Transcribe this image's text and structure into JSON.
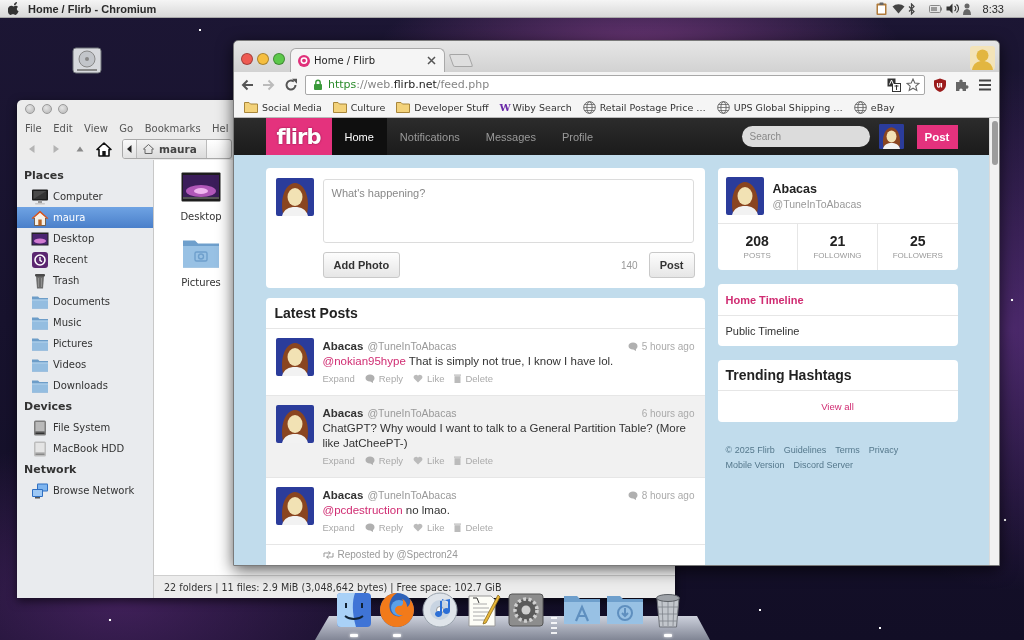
{
  "menu_bar": {
    "title": "Home / Flirb - Chromium",
    "clock": "8:33"
  },
  "file_manager": {
    "menu": [
      "File",
      "Edit",
      "View",
      "Go",
      "Bookmarks",
      "Hel"
    ],
    "path": "maura",
    "sidebar": [
      {
        "heading": "Places",
        "items": [
          {
            "label": "Computer",
            "kind": "computer",
            "selected": false
          },
          {
            "label": "maura",
            "kind": "home",
            "selected": true
          },
          {
            "label": "Desktop",
            "kind": "wallpaper",
            "selected": false
          },
          {
            "label": "Recent",
            "kind": "recent",
            "selected": false
          },
          {
            "label": "Trash",
            "kind": "trash",
            "selected": false
          },
          {
            "label": "Documents",
            "kind": "folder",
            "selected": false
          },
          {
            "label": "Music",
            "kind": "folder",
            "selected": false
          },
          {
            "label": "Pictures",
            "kind": "folder",
            "selected": false
          },
          {
            "label": "Videos",
            "kind": "folder",
            "selected": false
          },
          {
            "label": "Downloads",
            "kind": "folder",
            "selected": false
          }
        ]
      },
      {
        "heading": "Devices",
        "items": [
          {
            "label": "File System",
            "kind": "drive",
            "selected": false
          },
          {
            "label": "MacBook HDD",
            "kind": "disk",
            "selected": false
          }
        ]
      },
      {
        "heading": "Network",
        "items": [
          {
            "label": "Browse Network",
            "kind": "network",
            "selected": false
          }
        ]
      }
    ],
    "files": [
      {
        "name": "Desktop",
        "kind": "wallpaper"
      },
      {
        "name": "Pictures",
        "kind": "folder"
      }
    ],
    "status_bar": "22 folders | 11 files: 2.9 MiB (3,048,642 bytes) | Free space: 102.7 GiB"
  },
  "browser": {
    "tabs": [
      {
        "title": "Home / Flirb",
        "selected": true
      }
    ],
    "url": [
      {
        "text": "https",
        "kind": "scheme"
      },
      {
        "text": "://web.",
        "kind": "dim"
      },
      {
        "text": "flirb.net",
        "kind": "host"
      },
      {
        "text": "/feed.php",
        "kind": "dim"
      }
    ],
    "bookmarks": [
      {
        "label": "Social Media",
        "kind": "folder"
      },
      {
        "label": "Culture",
        "kind": "folder"
      },
      {
        "label": "Developer Stuff",
        "kind": "folder"
      },
      {
        "label": "Wiby Search",
        "kind": "letter",
        "icon": "W"
      },
      {
        "label": "Retail Postage Price …",
        "kind": "globe"
      },
      {
        "label": "UPS Global Shipping …",
        "kind": "globe"
      },
      {
        "label": "eBay",
        "kind": "globe"
      }
    ]
  },
  "flirb": {
    "logo": "flirb",
    "nav": [
      {
        "label": "Home",
        "selected": true
      },
      {
        "label": "Notifications",
        "selected": false
      },
      {
        "label": "Messages",
        "selected": false
      },
      {
        "label": "Profile",
        "selected": false
      }
    ],
    "search": {
      "placeholder": "Search"
    },
    "post_button": "Post",
    "compose": {
      "placeholder": "What's happening?",
      "add_photo": "Add Photo",
      "counter": "140",
      "post_button": "Post"
    },
    "feed": {
      "title": "Latest Posts",
      "posts": [
        {
          "name": "Abacas",
          "handle": "@TuneInToAbacas",
          "time": "5 hours ago",
          "in_reply": true,
          "highlighted": false,
          "mention": "@nokian95hype",
          "text": "That is simply not true, I know I have lol.",
          "actions": [
            {
              "label": "Expand",
              "kind": "expand"
            },
            {
              "label": "Reply",
              "kind": "reply"
            },
            {
              "label": "Like",
              "kind": "like"
            },
            {
              "label": "Delete",
              "kind": "delete"
            }
          ]
        },
        {
          "name": "Abacas",
          "handle": "@TuneInToAbacas",
          "time": "6 hours ago",
          "in_reply": false,
          "highlighted": true,
          "text": "ChatGPT? Why would I want to talk to a General Partition Table? (More like JatCheePT-)",
          "actions": [
            {
              "label": "Expand",
              "kind": "expand"
            },
            {
              "label": "Reply",
              "kind": "reply"
            },
            {
              "label": "Like",
              "kind": "like"
            },
            {
              "label": "Delete",
              "kind": "delete"
            }
          ]
        },
        {
          "name": "Abacas",
          "handle": "@TuneInToAbacas",
          "time": "8 hours ago",
          "in_reply": true,
          "highlighted": false,
          "mention": "@pcdestruction",
          "text": "no lmao.",
          "actions": [
            {
              "label": "Expand",
              "kind": "expand"
            },
            {
              "label": "Reply",
              "kind": "reply"
            },
            {
              "label": "Like",
              "kind": "like"
            },
            {
              "label": "Delete",
              "kind": "delete"
            }
          ]
        }
      ],
      "repost": "Reposted by @Spectron24"
    },
    "profile": {
      "name": "Abacas",
      "handle": "@TuneInToAbacas",
      "stats": [
        {
          "value": "208",
          "label": "POSTS"
        },
        {
          "value": "21",
          "label": "FOLLOWING"
        },
        {
          "value": "25",
          "label": "FOLLOWERS"
        }
      ]
    },
    "timelines": [
      {
        "label": "Home Timeline",
        "selected": true
      },
      {
        "label": "Public Timeline",
        "selected": false
      }
    ],
    "trending": {
      "title": "Trending Hashtags",
      "link": "View all"
    },
    "footer": [
      "© 2025 Flirb",
      "Guidelines",
      "Terms",
      "Privacy",
      "Mobile Version",
      "Discord Server"
    ]
  },
  "dock": [
    {
      "kind": "finder",
      "running": true
    },
    {
      "kind": "browser",
      "running": true
    },
    {
      "kind": "music",
      "running": false
    },
    {
      "kind": "editor",
      "running": false
    },
    {
      "kind": "settings",
      "running": false
    },
    {
      "kind": "divider"
    },
    {
      "kind": "apps",
      "running": false
    },
    {
      "kind": "downloads",
      "running": false
    },
    {
      "kind": "trash",
      "running": true
    }
  ]
}
